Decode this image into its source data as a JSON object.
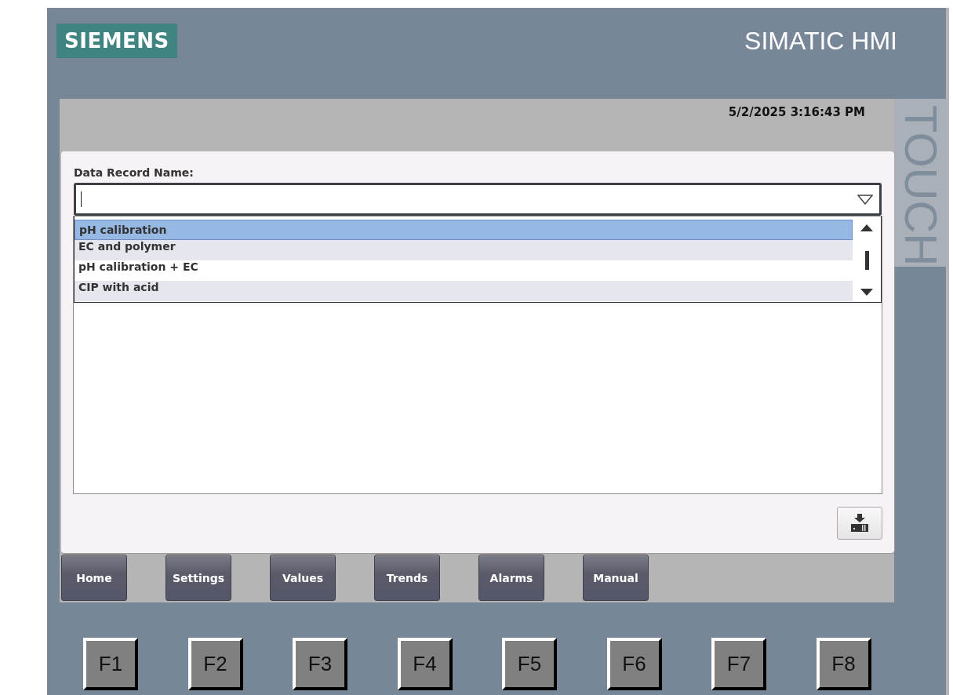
{
  "header": {
    "logo": "SIEMENS",
    "product": "SIMATIC HMI",
    "side_label": "TOUCH"
  },
  "screen": {
    "datetime": "5/2/2025 3:16:43 PM",
    "record_field": {
      "label": "Data Record Name:",
      "focused": true
    },
    "dropdown": [
      {
        "label": "pH calibration",
        "selected": true
      },
      {
        "label": "EC and polymer",
        "selected": false
      },
      {
        "label": "pH calibration + EC",
        "selected": false
      },
      {
        "label": "CIP with acid",
        "selected": false
      }
    ],
    "nav_buttons": [
      "Home",
      "Settings",
      "Values",
      "Trends",
      "Alarms",
      "Manual"
    ]
  },
  "function_keys": [
    "F1",
    "F2",
    "F3",
    "F4",
    "F5",
    "F6",
    "F7",
    "F8"
  ]
}
